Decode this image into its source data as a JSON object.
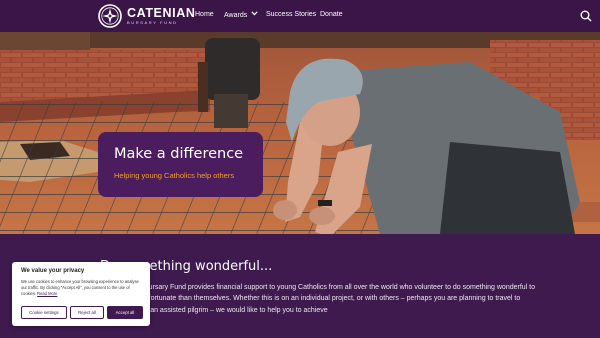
{
  "header": {
    "logo_title": "CATENIAN",
    "logo_subtitle": "BURSARY FUND",
    "nav": [
      {
        "label": "Home"
      },
      {
        "label": "Awards"
      },
      {
        "label": "Success Stories"
      },
      {
        "label": "Donate"
      }
    ]
  },
  "hero": {
    "title": "Make a difference",
    "subtitle": "Helping young Catholics help others"
  },
  "content": {
    "heading": "Do something wonderful...",
    "paragraph": "The Catenian Bursary Fund provides financial support to young Catholics from all over the world who volunteer to do something wonderful to help those less fortunate than themselves. Whether this is on an individual project, or with others – perhaps you are planning to travel to Lourdes to help an assisted pilgrim – we would like to help you to achieve"
  },
  "cookie": {
    "title": "We value your privacy",
    "text": "We use cookies to enhance your browsing experience to analyse our traffic. By clicking \"Accept All\", you consent to the use of cookies.",
    "link": "Read More",
    "settings": "Cookie settings",
    "reject": "Reject all",
    "accept": "Accept all"
  },
  "colors": {
    "brand_purple": "#3f1a4f",
    "accent_orange": "#f0a02a"
  }
}
